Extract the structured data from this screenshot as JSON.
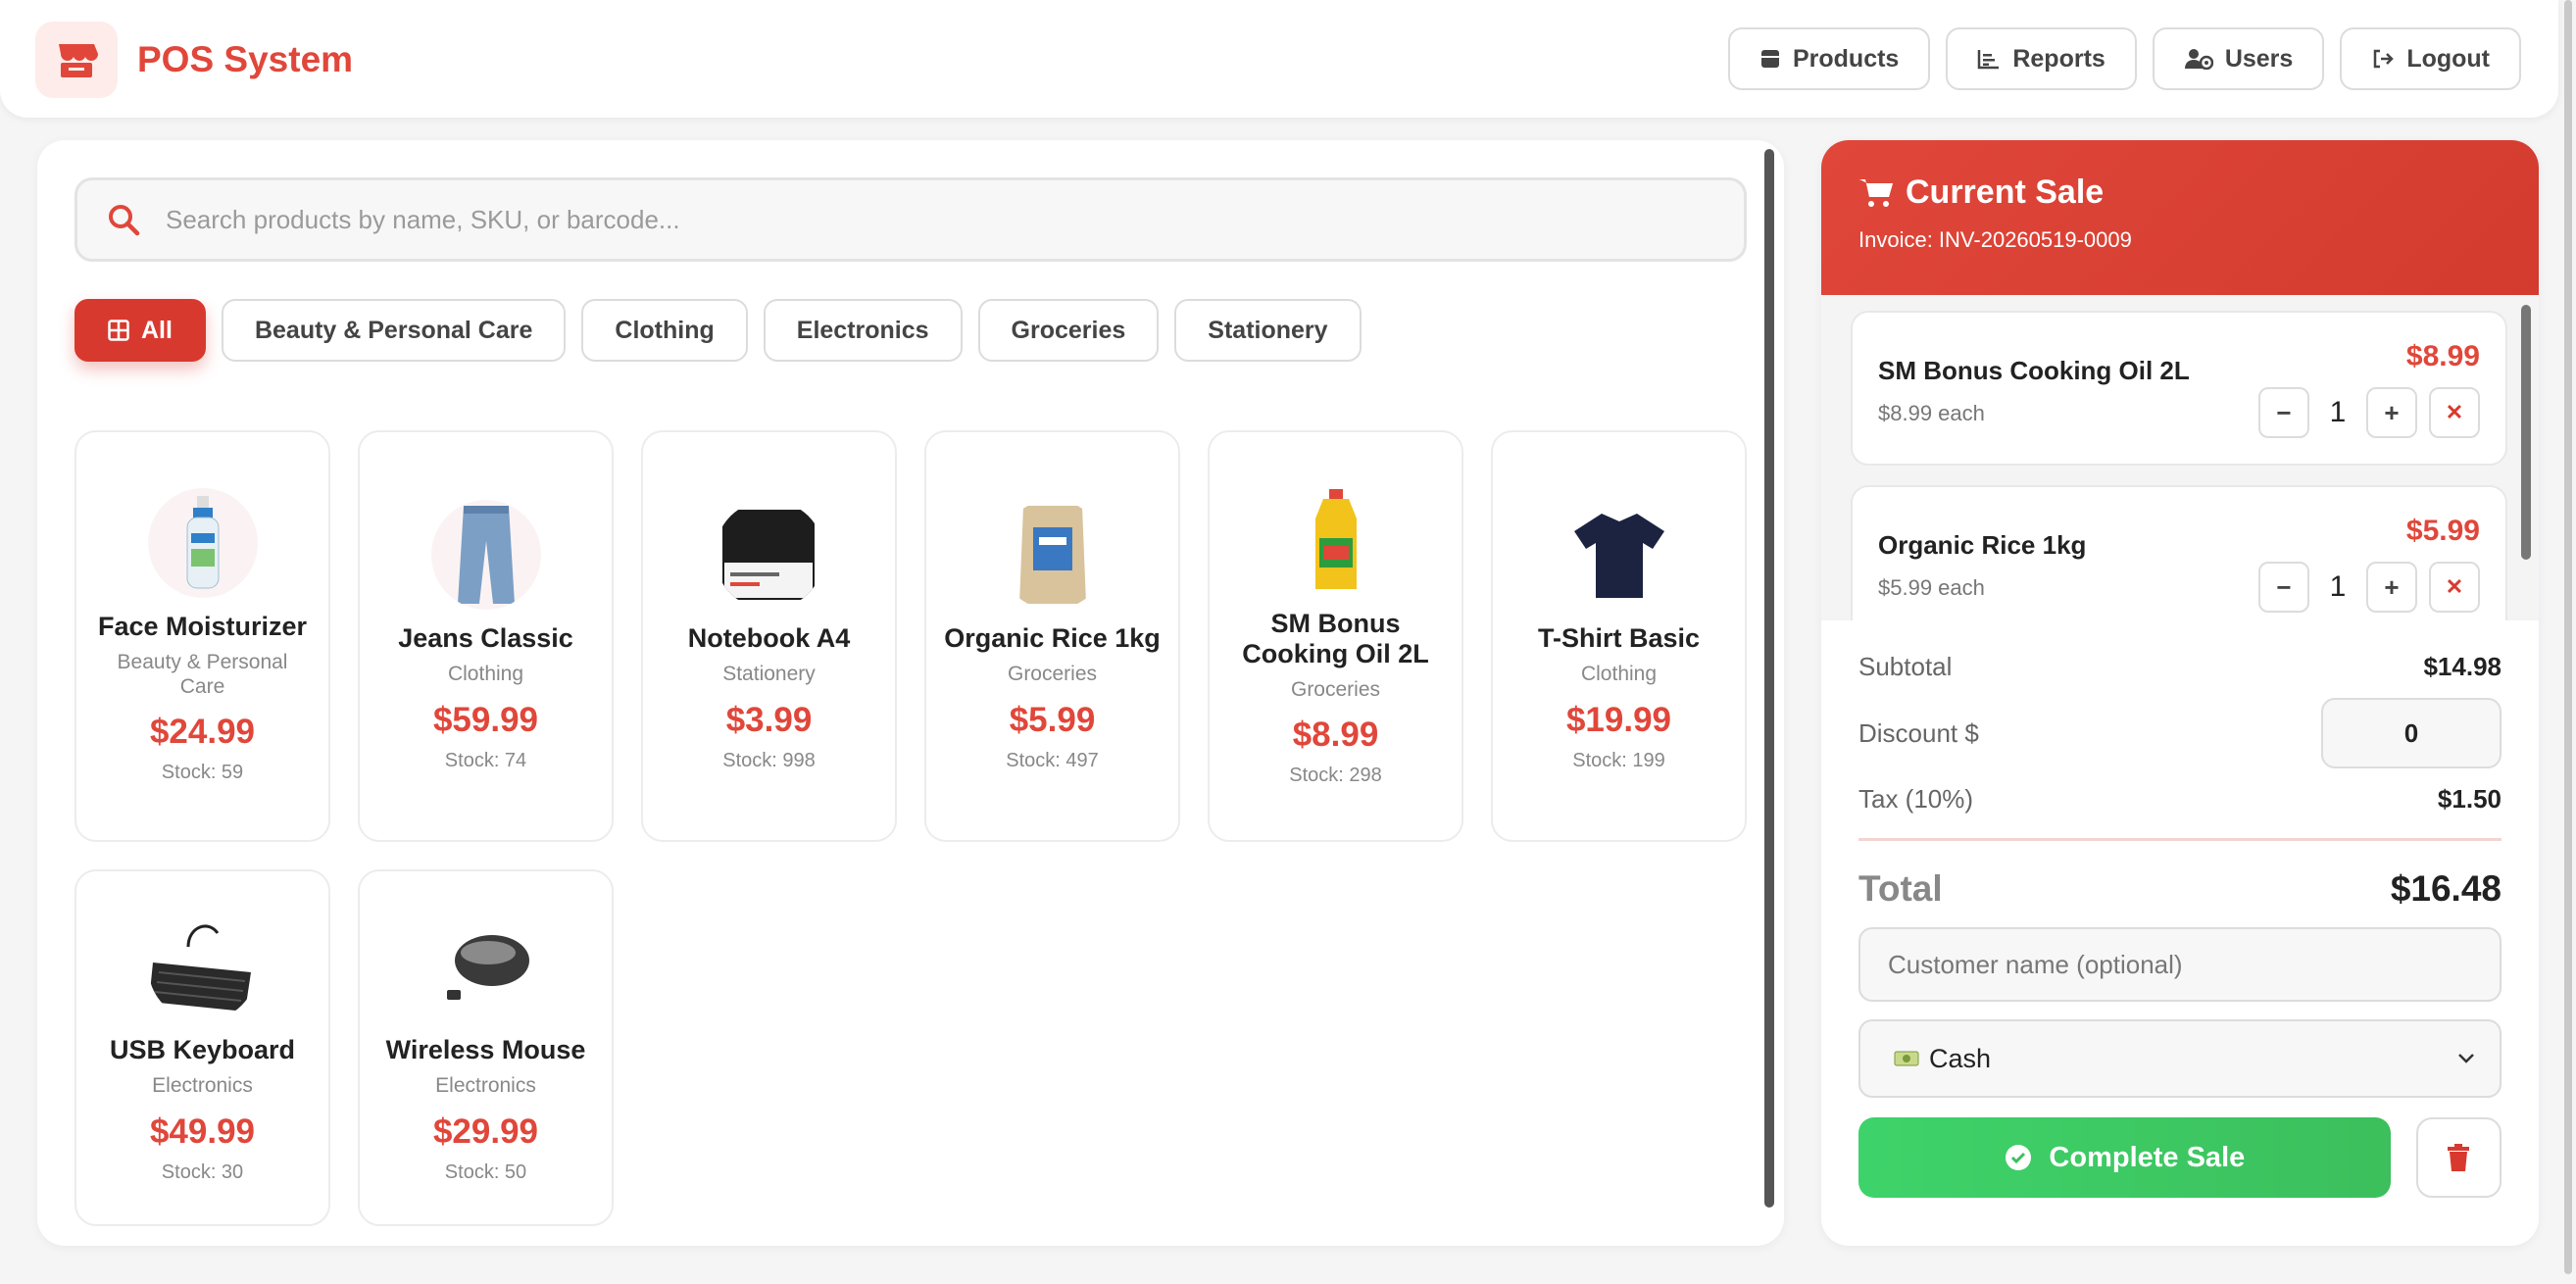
{
  "app": {
    "title": "POS System",
    "accent_color": "#e0473a",
    "success_color": "#3cbf5c"
  },
  "nav": [
    {
      "label": "Products",
      "icon": "box-icon"
    },
    {
      "label": "Reports",
      "icon": "chart-icon"
    },
    {
      "label": "Users",
      "icon": "users-icon"
    },
    {
      "label": "Logout",
      "icon": "logout-icon"
    }
  ],
  "search": {
    "placeholder": "Search products by name, SKU, or barcode...",
    "value": ""
  },
  "categories": [
    {
      "label": "All",
      "active": true
    },
    {
      "label": "Beauty & Personal Care",
      "active": false
    },
    {
      "label": "Clothing",
      "active": false
    },
    {
      "label": "Electronics",
      "active": false
    },
    {
      "label": "Groceries",
      "active": false
    },
    {
      "label": "Stationery",
      "active": false
    }
  ],
  "products": [
    {
      "name": "Face Moisturizer",
      "category": "Beauty & Personal Care",
      "price": "$24.99",
      "stock": "Stock: 59",
      "image": "moisturizer-bottle"
    },
    {
      "name": "Jeans Classic",
      "category": "Clothing",
      "price": "$59.99",
      "stock": "Stock: 74",
      "image": "jeans"
    },
    {
      "name": "Notebook A4",
      "category": "Stationery",
      "price": "$3.99",
      "stock": "Stock: 998",
      "image": "notebook"
    },
    {
      "name": "Organic Rice 1kg",
      "category": "Groceries",
      "price": "$5.99",
      "stock": "Stock: 497",
      "image": "rice-bag"
    },
    {
      "name": "SM Bonus Cooking Oil 2L",
      "category": "Groceries",
      "price": "$8.99",
      "stock": "Stock: 298",
      "image": "oil-bottle"
    },
    {
      "name": "T-Shirt Basic",
      "category": "Clothing",
      "price": "$19.99",
      "stock": "Stock: 199",
      "image": "tshirt"
    },
    {
      "name": "USB Keyboard",
      "category": "Electronics",
      "price": "$49.99",
      "stock": "Stock: 30",
      "image": "keyboard"
    },
    {
      "name": "Wireless Mouse",
      "category": "Electronics",
      "price": "$29.99",
      "stock": "Stock: 50",
      "image": "mouse"
    }
  ],
  "sale": {
    "title": "Current Sale",
    "invoice": "Invoice: INV-20260519-0009",
    "items": [
      {
        "name": "SM Bonus Cooking Oil 2L",
        "each": "$8.99 each",
        "price": "$8.99",
        "qty": "1"
      },
      {
        "name": "Organic Rice 1kg",
        "each": "$5.99 each",
        "price": "$5.99",
        "qty": "1"
      }
    ],
    "subtotal_label": "Subtotal",
    "subtotal": "$14.98",
    "discount_label": "Discount $",
    "discount_value": "0",
    "tax_label": "Tax (10%)",
    "tax": "$1.50",
    "total_label": "Total",
    "total": "$16.48",
    "customer_placeholder": "Customer name (optional)",
    "payment_method": "Cash",
    "complete_label": "Complete Sale"
  }
}
